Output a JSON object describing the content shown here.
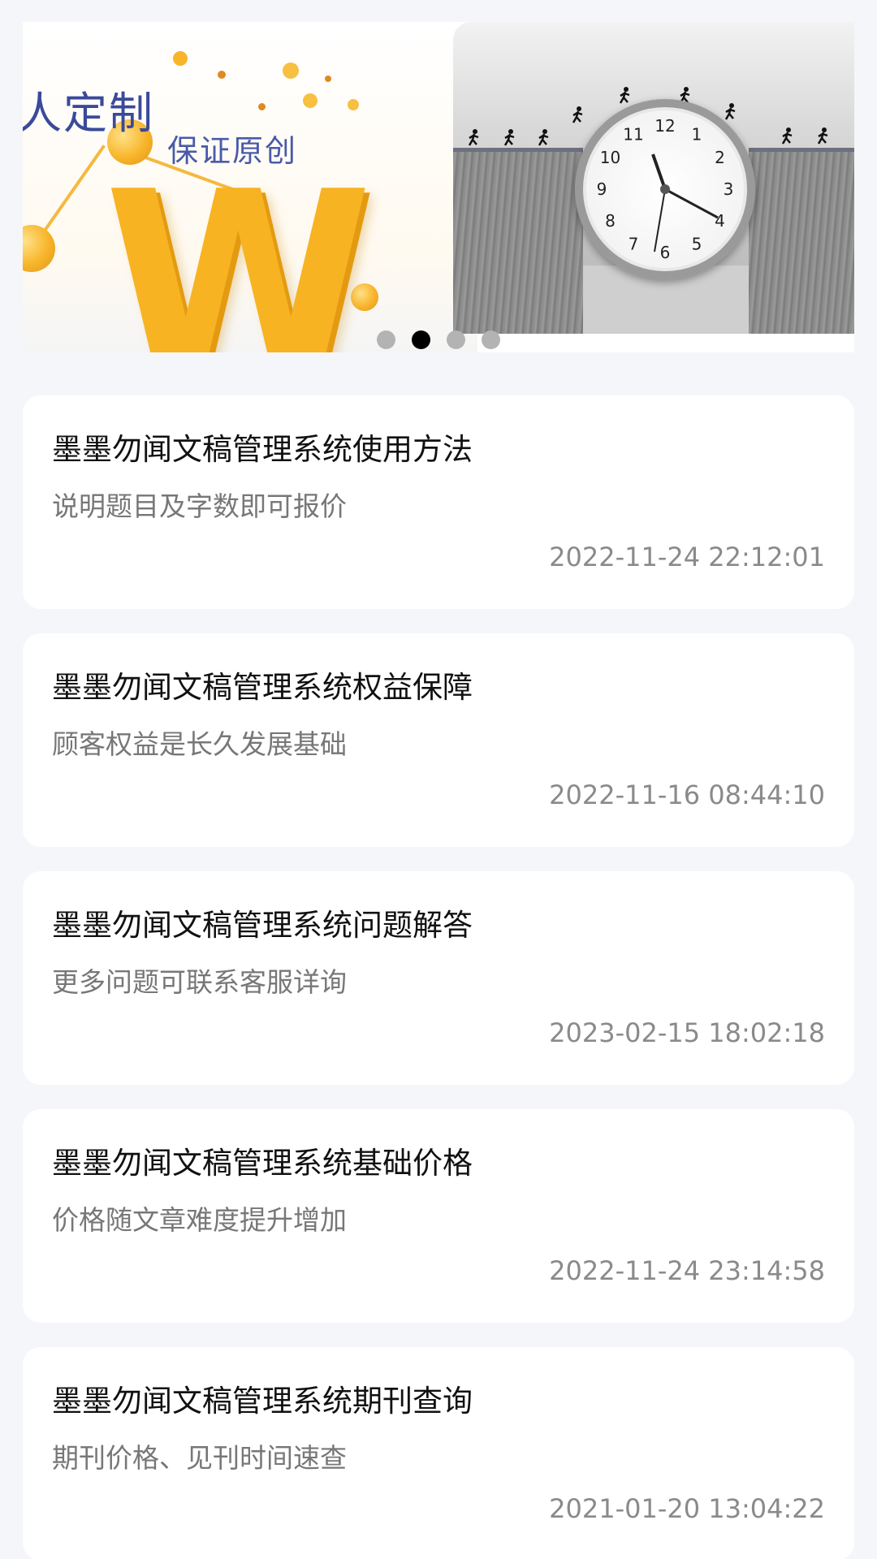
{
  "banner": {
    "slide_text_1": "人定制",
    "slide_text_2": "保证原创",
    "slide_letter": "W",
    "clock_numbers": [
      "12",
      "1",
      "2",
      "3",
      "4",
      "5",
      "6",
      "7",
      "8",
      "9",
      "10",
      "11"
    ],
    "dots_count": 4,
    "active_dot": 2
  },
  "articles": [
    {
      "title": "墨墨勿闻文稿管理系统使用方法",
      "subtitle": "说明题目及字数即可报价",
      "time": "2022-11-24 22:12:01"
    },
    {
      "title": "墨墨勿闻文稿管理系统权益保障",
      "subtitle": "顾客权益是长久发展基础",
      "time": "2022-11-16 08:44:10"
    },
    {
      "title": "墨墨勿闻文稿管理系统问题解答",
      "subtitle": "更多问题可联系客服详询",
      "time": "2023-02-15 18:02:18"
    },
    {
      "title": "墨墨勿闻文稿管理系统基础价格",
      "subtitle": "价格随文章难度提升增加",
      "time": "2022-11-24 23:14:58"
    },
    {
      "title": "墨墨勿闻文稿管理系统期刊查询",
      "subtitle": "期刊价格、见刊时间速查",
      "time": "2021-01-20 13:04:22"
    }
  ]
}
